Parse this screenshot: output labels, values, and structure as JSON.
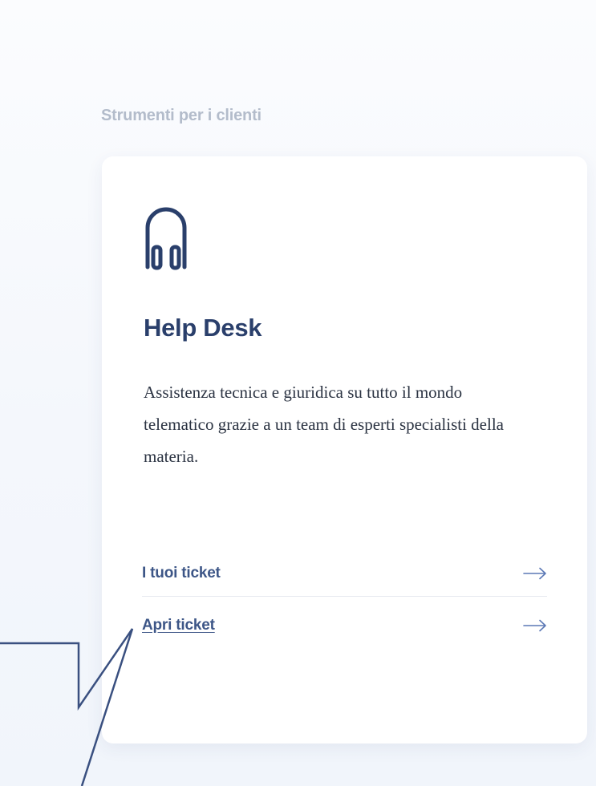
{
  "section": {
    "title": "Strumenti per i clienti"
  },
  "card": {
    "icon": "headset-icon",
    "title": "Help Desk",
    "description": "Assistenza tecnica e giuridica su tutto il mondo telematico grazie a un team di esperti specialisti della materia.",
    "links": [
      {
        "label": "I tuoi ticket",
        "icon": "arrow-right-icon"
      },
      {
        "label": "Apri ticket",
        "icon": "arrow-right-icon"
      }
    ]
  },
  "colors": {
    "section_title": "#b3bccb",
    "card_title": "#2a3f6b",
    "link": "#3d5687",
    "icon": "#2a3f6b",
    "arrow": "#5b78b5",
    "callout_stroke": "#3a5080"
  }
}
